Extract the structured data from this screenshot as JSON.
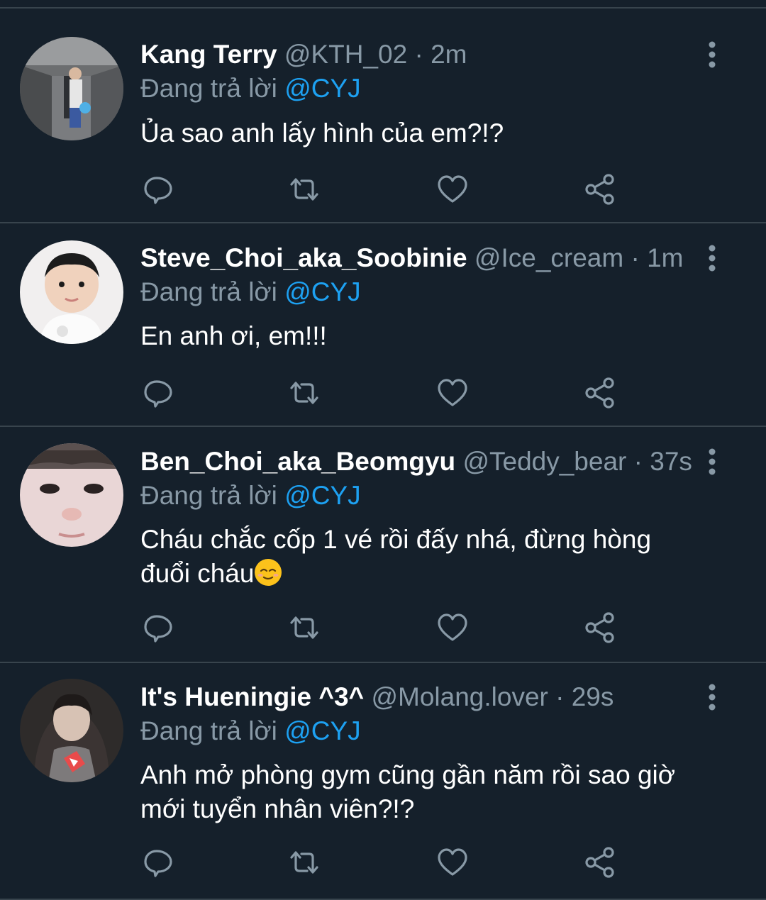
{
  "tweets": [
    {
      "name": "Kang Terry",
      "handle": "@KTH_02",
      "dot": "·",
      "time": "2m",
      "reply_prefix": "Đang trả lời",
      "reply_mention": "@CYJ",
      "text_lines": [
        "Ủa sao anh lấy hình của em?!?"
      ]
    },
    {
      "name": "Steve_Choi_aka_Soobinie",
      "handle": "@Ice_cream",
      "dot": "·",
      "time": "1m",
      "reply_prefix": "Đang trả lời",
      "reply_mention": "@CYJ",
      "text_lines": [
        "En anh ơi, em!!!"
      ]
    },
    {
      "name": "Ben_Choi_aka_Beomgyu",
      "handle": "@Teddy_bear",
      "dot": "·",
      "time": "37s",
      "reply_prefix": "Đang trả lời",
      "reply_mention": "@CYJ",
      "text_lines": [
        "Cháu chắc cốp 1 vé rồi đấy nhá, đừng hòng",
        "đuổi cháu"
      ],
      "emoji": "relieved-face-emoji"
    },
    {
      "name": "It's Hueningie ^3^",
      "handle": "@Molang.lover",
      "dot": "·",
      "time": "29s",
      "reply_prefix": "Đang trả lời",
      "reply_mention": "@CYJ",
      "text_lines": [
        "Anh mở phòng gym cũng gần năm rồi sao giờ",
        "mới tuyển nhân viên?!?"
      ]
    }
  ],
  "icons": {
    "reply": "speech-bubble-icon",
    "retweet": "retweet-arrows-icon",
    "like": "heart-outline-icon",
    "share": "share-nodes-icon",
    "more": "vertical-dots-icon"
  },
  "colors": {
    "background": "#15202b",
    "divider": "#38444d",
    "secondary_text": "#8899a6",
    "mention": "#1da1f2",
    "primary_text": "#ffffff"
  }
}
